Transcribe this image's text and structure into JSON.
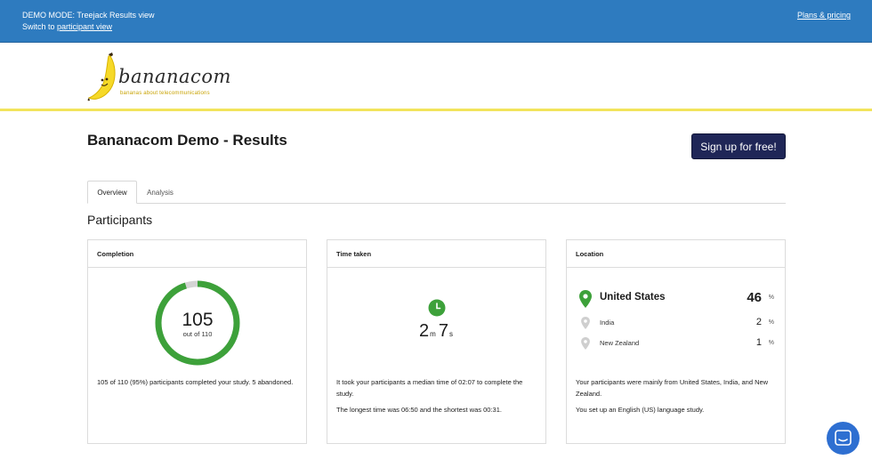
{
  "demo_bar": {
    "mode_text": "DEMO MODE: Treejack Results view",
    "switch_prefix": "Switch to ",
    "switch_link": "participant view",
    "plans_link": "Plans & pricing"
  },
  "brand": {
    "wordmark": "bananacom",
    "tagline": "bananas about telecommunications"
  },
  "header": {
    "title": "Bananacom Demo - Results",
    "signup_label": "Sign up for free!"
  },
  "tabs": [
    {
      "label": "Overview",
      "active": true
    },
    {
      "label": "Analysis",
      "active": false
    }
  ],
  "participants": {
    "section_title": "Participants",
    "completion": {
      "title": "Completion",
      "completed": "105",
      "out_of": "out of 110",
      "completed_fraction": 0.95,
      "summary": "105 of 110 (95%) participants completed your study. 5 abandoned."
    },
    "time_taken": {
      "title": "Time taken",
      "minutes": "2",
      "minutes_unit": "m",
      "seconds": "7",
      "seconds_unit": "s",
      "median_text": "It took your participants a median time of 02:07 to complete the study.",
      "range_text": "The longest time was 06:50 and the shortest was 00:31."
    },
    "location": {
      "title": "Location",
      "countries": [
        {
          "name": "United States",
          "value": "46",
          "unit": "%"
        },
        {
          "name": "India",
          "value": "2",
          "unit": "%"
        },
        {
          "name": "New Zealand",
          "value": "1",
          "unit": "%"
        }
      ],
      "summary": "Your participants were mainly from United States, India, and New Zealand.",
      "language_note": "You set up an English (US) language study."
    }
  },
  "colors": {
    "demo_bar": "#2e7bbf",
    "brand_rule": "#f2e45c",
    "signup_button": "#1f2657",
    "accent_green": "#3da13a",
    "ring_track": "#d4d4d4",
    "chat_button": "#2e6fd1"
  },
  "icons": {
    "clock": "clock-icon",
    "location_pin": "map-pin-icon",
    "chat": "chat-bubble-icon",
    "logo": "banana-logo-icon"
  }
}
